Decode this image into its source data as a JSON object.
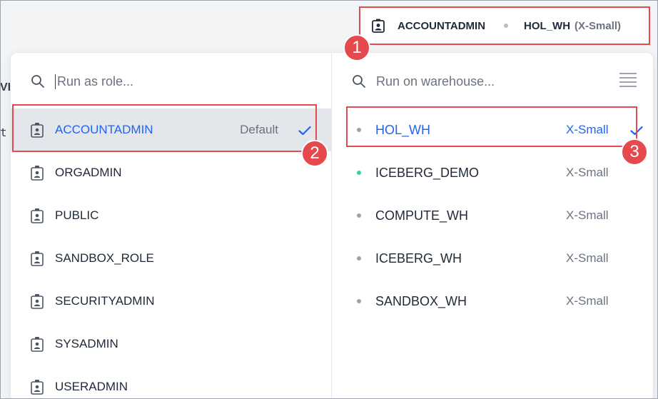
{
  "background": {
    "left_text_1": "VF",
    "left_text_2": "t"
  },
  "context_bar": {
    "role": "ACCOUNTADMIN",
    "warehouse": "HOL_WH",
    "size": "(X-Small)",
    "role_icon": "user-badge-icon"
  },
  "badges": [
    "1",
    "2",
    "3"
  ],
  "role_panel": {
    "search_placeholder": "Run as role...",
    "search_icon": "search-icon",
    "items": [
      {
        "label": "ACCOUNTADMIN",
        "note": "Default",
        "selected": true
      },
      {
        "label": "ORGADMIN",
        "note": "",
        "selected": false
      },
      {
        "label": "PUBLIC",
        "note": "",
        "selected": false
      },
      {
        "label": "SANDBOX_ROLE",
        "note": "",
        "selected": false
      },
      {
        "label": "SECURITYADMIN",
        "note": "",
        "selected": false
      },
      {
        "label": "SYSADMIN",
        "note": "",
        "selected": false
      },
      {
        "label": "USERADMIN",
        "note": "",
        "selected": false
      }
    ]
  },
  "warehouse_panel": {
    "search_placeholder": "Run on warehouse...",
    "search_icon": "search-icon",
    "menu_icon": "list-lines-icon",
    "items": [
      {
        "label": "HOL_WH",
        "size": "X-Small",
        "selected": true,
        "status_color": "#9ca3af"
      },
      {
        "label": "ICEBERG_DEMO",
        "size": "X-Small",
        "selected": false,
        "status_color": "#34d399"
      },
      {
        "label": "COMPUTE_WH",
        "size": "X-Small",
        "selected": false,
        "status_color": "#9ca3af"
      },
      {
        "label": "ICEBERG_WH",
        "size": "X-Small",
        "selected": false,
        "status_color": "#9ca3af"
      },
      {
        "label": "SANDBOX_WH",
        "size": "X-Small",
        "selected": false,
        "status_color": "#9ca3af"
      }
    ]
  },
  "colors": {
    "accent": "#2563eb",
    "highlight": "#e5484d",
    "selected_bg": "#e3e6eb"
  }
}
